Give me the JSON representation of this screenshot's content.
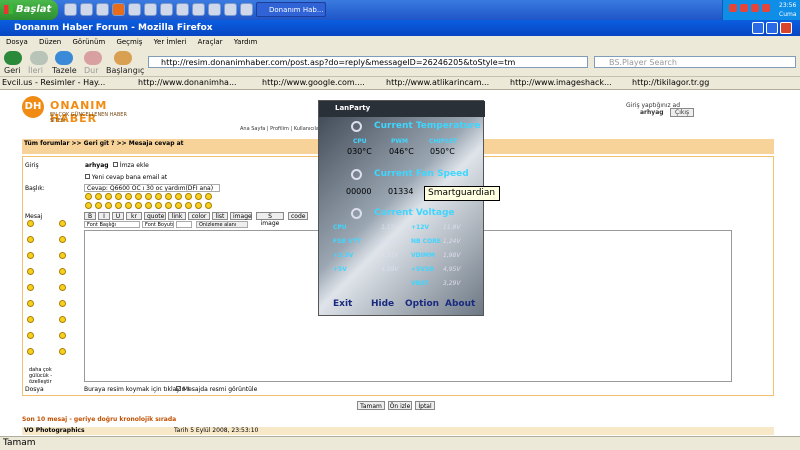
{
  "taskbar": {
    "start_label": "Başlat",
    "task_label": "Donanım Hab...",
    "clock": "23:56",
    "day": "Cuma"
  },
  "window": {
    "title": "Donanım Haber Forum - Mozilla Firefox"
  },
  "menu": [
    "Dosya",
    "Düzen",
    "Görünüm",
    "Geçmiş",
    "Yer İmleri",
    "Araçlar",
    "Yardım"
  ],
  "nav": {
    "back": "Geri",
    "forward": "İleri",
    "reload": "Tazele",
    "stop": "Dur",
    "home": "Başlangıç"
  },
  "url": "http://resim.donanimhaber.com/post.asp?do=reply&messageID=26246205&toStyle=tm",
  "search_placeholder": "BS.Player Search",
  "bookmarks": [
    "Evcil.us - Resimler - Hay...",
    "http://www.donanimha...",
    "http://www.google.com....",
    "http://www.atlikarincam...",
    "http://www.imageshack...",
    "http://tikilagor.tr.gg"
  ],
  "site": {
    "logo_mark": "DH",
    "logo_title": "ONANIM HABER",
    "logo_sub": "EN ÇOK GÜNCELLENEN HABER SİTESİ",
    "login_text": "Giriş yaptığınız ad",
    "login_user": "arhyag",
    "logout": "Çıkış",
    "topnav": "Ana Sayfa | Profilim | Kullanıcılar | Arama | Grup | Forumlar | Fotoğraf albümleri",
    "crumb": "Tüm forumlar >> Geri git ? >> Mesaja cevap at",
    "giris_label": "Giriş",
    "user": "arhyag",
    "imza_label": "İmza ekle",
    "email_label": "Yeni cevap bana email at",
    "baslik_label": "Başlık:",
    "baslik_value": "Cevap: Q6600 OC ı 30 oc yardım(DFI ana)",
    "mesaj_label": "Mesaj",
    "toolbar": [
      "B",
      "I",
      "U",
      "kr",
      "quote",
      "link",
      "color",
      "list",
      "image",
      "S image",
      "code"
    ],
    "font_label": "Font Başlığı",
    "size_label": "Font Boyutu",
    "preview_label": "Önizleme alanı",
    "smiley_more": "daha çok gülücük - özelleştir",
    "dosya_label": "Dosya",
    "dosya_text": "Buraya resim koymak için tıklayın !",
    "mesaj_check": "Mesajda resmi görüntüle",
    "btn_tamam": "Tamam",
    "btn_onizle": "Ön izle",
    "btn_iptal": "İptal",
    "footer1": "Son 10 mesaj - geriye doğru kronolojik sırada",
    "footer2_user": "VO Photographics",
    "footer2_date": "Tarih 5 Eylül 2008, 23:53:10"
  },
  "sg": {
    "brand": "LanParty",
    "temp_title": "Current Temperature",
    "temp_labels": [
      "CPU",
      "PWM",
      "CHIPSET"
    ],
    "temps": [
      "030°C",
      "046°C",
      "050°C"
    ],
    "fan_title": "Current Fan Speed",
    "fans": [
      "00000",
      "01334"
    ],
    "volt_title": "Current Voltage",
    "volts": [
      [
        "CPU",
        "1,15V",
        "+12V",
        "11,9V"
      ],
      [
        "FSB VTT",
        "1,16V",
        "NB CORE",
        "1,24V"
      ],
      [
        "+3.3V",
        "3,31V",
        "VDIMM",
        "1,98V"
      ],
      [
        "+5V",
        "4,89V",
        "+5VSB",
        "4,95V"
      ],
      [
        "",
        "",
        "VBAT",
        "3,29V"
      ]
    ],
    "buttons": [
      "Exit",
      "Hide",
      "Option",
      "About"
    ]
  },
  "tooltip": "Smartguardian",
  "status": "Tamam",
  "colors": {
    "accent": "#f08c14",
    "sg_cyan": "#3fd6ff",
    "led_green": "#1cff3a"
  }
}
